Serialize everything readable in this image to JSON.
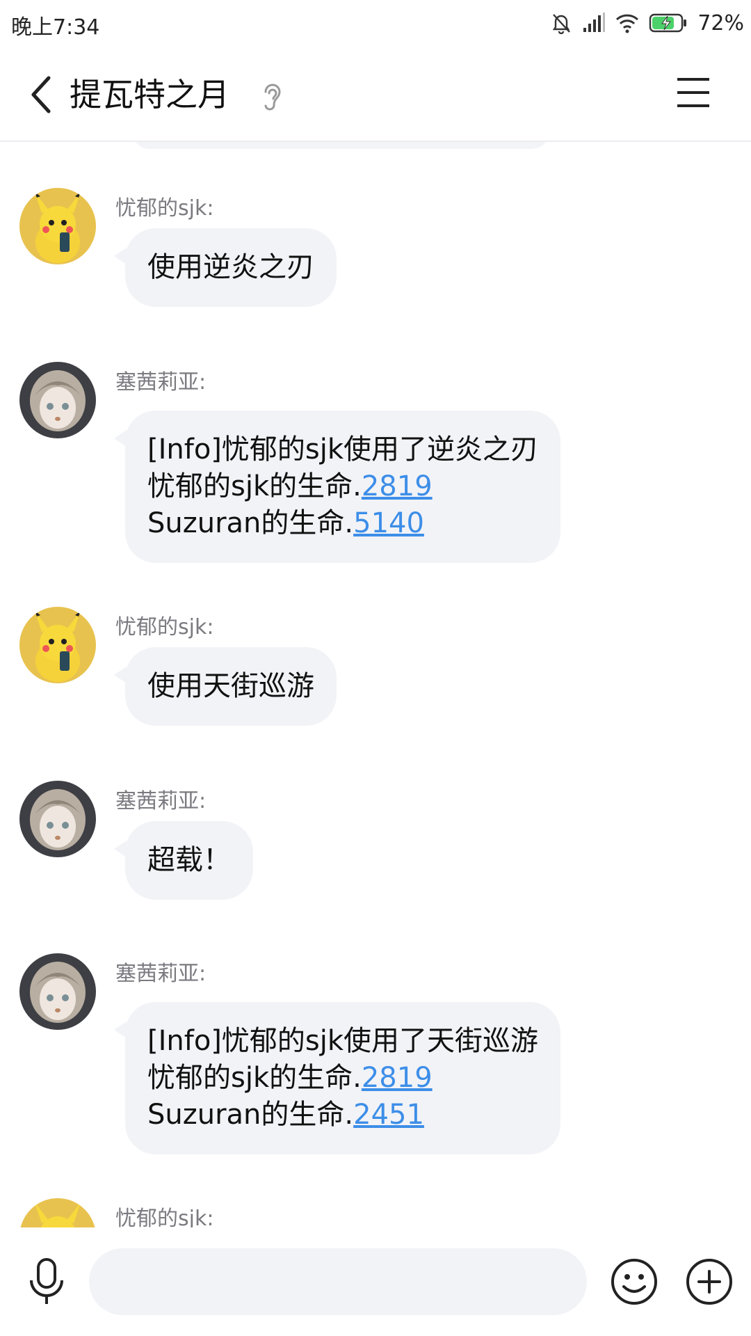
{
  "status_bar": {
    "time": "晚上7:34",
    "battery_percent": "72%",
    "icons": [
      "bell-off-icon",
      "signal-icon",
      "wifi-icon",
      "battery-charging-icon"
    ]
  },
  "header": {
    "title": "提瓦特之月",
    "icons": [
      "back-arrow-icon",
      "ear-icon",
      "menu-icon"
    ]
  },
  "messages": [
    {
      "sender": "忧郁的sjk:",
      "avatar": "pikachu-avatar",
      "lines": [
        "使用逆炎之刃"
      ]
    },
    {
      "sender": "塞茜莉亚:",
      "avatar": "anime-girl-avatar",
      "line1": "[Info]忧郁的sjk使用了逆炎之刃",
      "line2_text": "忧郁的sjk的生命.",
      "line2_value": "2819",
      "line3_text": "Suzuran的生命.",
      "line3_value": "5140"
    },
    {
      "sender": "忧郁的sjk:",
      "avatar": "pikachu-avatar",
      "lines": [
        "使用天街巡游"
      ]
    },
    {
      "sender": "塞茜莉亚:",
      "avatar": "anime-girl-avatar",
      "lines": [
        "超载！"
      ]
    },
    {
      "sender": "塞茜莉亚:",
      "avatar": "anime-girl-avatar",
      "line1": "[Info]忧郁的sjk使用了天街巡游",
      "line2_text": "忧郁的sjk的生命.",
      "line2_value": "2819",
      "line3_text": "Suzuran的生命.",
      "line3_value": "2451"
    },
    {
      "sender": "忧郁的sjk:",
      "avatar": "pikachu-avatar"
    }
  ],
  "input_bar": {
    "placeholder": "",
    "icons": [
      "microphone-icon",
      "emoji-icon",
      "plus-icon"
    ]
  },
  "colors": {
    "bubble": "#f2f3f7",
    "link": "#3d8ee8",
    "sender": "#7a7a80"
  }
}
